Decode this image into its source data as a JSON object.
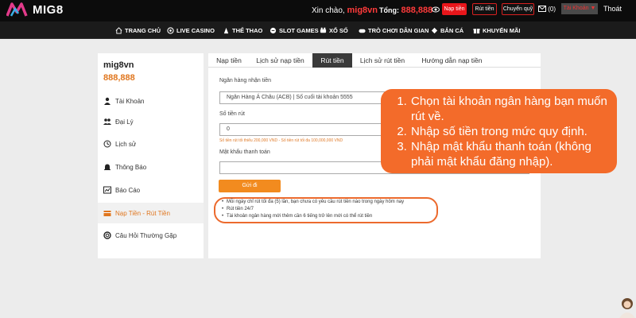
{
  "header": {
    "logo_text": "MIG8",
    "greeting": "Xin chào,",
    "username": "mig8vn",
    "total_label": "Tổng:",
    "total_amount": "888,888",
    "nap_tien": "Nạp tiền",
    "rut_tien": "Rút tiền",
    "chuyen_quy": "Chuyển quỹ",
    "mail_count": "(0)",
    "account_btn": "Tài Khoản ▼",
    "logout": "Thoát"
  },
  "nav": {
    "items": [
      "TRANG CHỦ",
      "LIVE CASINO",
      "THỂ THAO",
      "SLOT GAMES",
      "XỔ SỐ",
      "TRÒ CHƠI DÂN GIAN",
      "BẮN CÁ",
      "KHUYẾN MÃI"
    ]
  },
  "sidebar": {
    "username": "mig8vn",
    "balance": "888,888",
    "items": [
      "Tài Khoản",
      "Đại Lý",
      "Lịch sử",
      "Thông Báo",
      "Báo Cáo",
      "Nạp Tiền - Rút Tiền",
      "Câu Hỏi Thường Gặp"
    ]
  },
  "tabs": [
    "Nạp tiền",
    "Lịch sử nạp tiền",
    "Rút tiền",
    "Lịch sử rút tiền",
    "Hướng dẫn nạp tiền"
  ],
  "form": {
    "bank_label": "Ngân hàng nhận tiền",
    "bank_value": "Ngân Hàng Á Châu (ACB) | Số cuối tài khoản 5555",
    "amount_label": "Số tiền rút",
    "amount_value": "0",
    "amount_hint": "Số tiền rút tối thiểu 200,000 VND - Số tiền rút tối đa 100,000,000 VND",
    "password_label": "Mật khẩu thanh toán",
    "password_value": "",
    "submit": "Gửi đi"
  },
  "notes": [
    "Mỗi ngày chỉ rút tối đa (5) lần, bạn chưa có yêu cầu rút tiền nào trong ngày hôm nay",
    "Rút tiền 24/7",
    "Tài khoản ngân hàng mới thêm cần 6 tiếng trở lên mới có thể rút tiền"
  ],
  "callout": [
    "Chọn tài khoản ngân hàng bạn muốn rút về.",
    "Nhập số tiền trong mức quy định.",
    "Nhập mật khẩu thanh toán (không phải mật khẩu đăng nhập)."
  ],
  "colors": {
    "accent_orange": "#f36b2a",
    "brand_red": "#e8161b",
    "balance_orange": "#e0761e"
  }
}
